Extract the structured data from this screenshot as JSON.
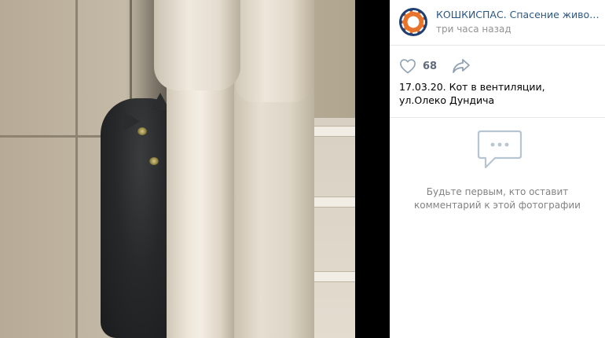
{
  "header": {
    "group_name": "КОШКИСПАС. Спасение животных Пе",
    "time": "три часа назад"
  },
  "actions": {
    "like_count": "68",
    "like_icon": "heart-icon",
    "share_icon": "share-arrow-icon"
  },
  "post": {
    "caption": "17.03.20. Кот в вентиляции, ул.Олеко Дундича"
  },
  "comments": {
    "empty_text": "Будьте первым, кто оставит комментарий к этой фотографии",
    "icon": "comment-bubble-icon"
  },
  "colors": {
    "link": "#2a5885",
    "muted": "#939393",
    "icon": "#aebccc"
  }
}
